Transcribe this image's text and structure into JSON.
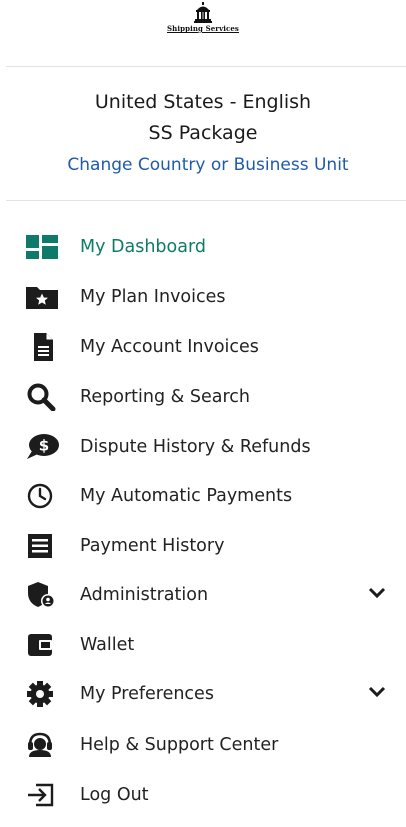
{
  "logo": {
    "text": "Shipping Services",
    "icon": "building-icon"
  },
  "locale": {
    "country_language": "United States - English",
    "business_unit": "SS Package",
    "change_link": "Change Country or Business Unit"
  },
  "colors": {
    "accent": "#0e7a6a",
    "link": "#1f5ba6",
    "icon": "#1c1c1c",
    "divider": "#e3e3e3"
  },
  "menu": {
    "items": [
      {
        "label": "My Dashboard",
        "icon": "dashboard-icon",
        "active": true
      },
      {
        "label": "My Plan Invoices",
        "icon": "folder-star-icon"
      },
      {
        "label": "My Account Invoices",
        "icon": "document-icon"
      },
      {
        "label": "Reporting & Search",
        "icon": "search-icon"
      },
      {
        "label": "Dispute History & Refunds",
        "icon": "dollar-chat-icon"
      },
      {
        "label": "My Automatic Payments",
        "icon": "clock-icon"
      },
      {
        "label": "Payment History",
        "icon": "receipt-icon"
      },
      {
        "label": "Administration",
        "icon": "shield-user-icon",
        "expandable": true
      },
      {
        "label": "Wallet",
        "icon": "wallet-icon"
      },
      {
        "label": "My Preferences",
        "icon": "gear-icon",
        "expandable": true
      },
      {
        "label": "Help & Support Center",
        "icon": "headset-icon"
      },
      {
        "label": "Log Out",
        "icon": "logout-icon"
      }
    ]
  }
}
